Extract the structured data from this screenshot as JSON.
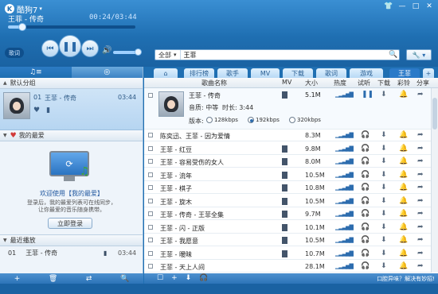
{
  "app": {
    "title": "酷狗7",
    "window_controls": [
      "shirt-icon",
      "minimize-icon",
      "maximize-icon",
      "close-icon"
    ]
  },
  "player": {
    "song_title": "王菲 - 传奇",
    "elapsed": "00:24",
    "total": "03:44",
    "progress": 0.11,
    "volume": 0.95,
    "mode_label": "歌词"
  },
  "search": {
    "scope": "全部",
    "query": "王菲",
    "tool_label": "🔧 ▾"
  },
  "left": {
    "tab_icons": [
      "playlist-icon",
      "disc-icon"
    ],
    "default_group": {
      "label": "默认分组",
      "num": "01",
      "title": "王菲 - 传奇",
      "duration": "03:44"
    },
    "favorites": {
      "label": "我的最爱",
      "welcome": "欢迎使用【我的最爱】",
      "desc1": "登录后，我的最爱列表可在线同步，",
      "desc2": "让你最爱的音乐随身携带。",
      "login_label": "立即登录"
    },
    "recent": {
      "label": "最近播放",
      "num": "01",
      "title": "王菲 - 传奇",
      "duration": "03:44"
    }
  },
  "tabs": [
    {
      "label": "⌂",
      "active": false
    },
    {
      "label": "排行榜",
      "active": false
    },
    {
      "label": "歌手",
      "active": false
    },
    {
      "label": "MV",
      "active": false
    },
    {
      "label": "下载",
      "active": false
    },
    {
      "label": "歌词",
      "active": false
    },
    {
      "label": "游戏",
      "active": false
    },
    {
      "label": "王菲",
      "active": true
    },
    {
      "label": "+",
      "active": false
    }
  ],
  "columns": {
    "name": "歌曲名称",
    "mv": "MV",
    "size": "大小",
    "heat": "热度",
    "listen": "试听",
    "download": "下载",
    "ringtone": "彩铃",
    "share": "分享"
  },
  "expanded": {
    "name": "王菲 - 传奇",
    "quality": "音质: 中等",
    "duration": "时长: 3:44",
    "size": "5.1M",
    "version_label": "版本:",
    "versions": [
      "128kbps",
      "192kbps",
      "320kbps"
    ],
    "selected_version": 1
  },
  "songs": [
    {
      "name": "陈奕迅、王菲 - 因为爱情",
      "mv": false,
      "size": "8.3M"
    },
    {
      "name": "王菲 - 红豆",
      "mv": true,
      "size": "9.8M"
    },
    {
      "name": "王菲 - 容易受伤的女人",
      "mv": true,
      "size": "8.0M"
    },
    {
      "name": "王菲 - 流年",
      "mv": true,
      "size": "10.5M"
    },
    {
      "name": "王菲 - 棋子",
      "mv": true,
      "size": "10.8M"
    },
    {
      "name": "王菲 - 旋木",
      "mv": true,
      "size": "10.5M"
    },
    {
      "name": "王菲 - 传奇 - 王菲全集",
      "mv": true,
      "size": "9.7M"
    },
    {
      "name": "王菲 - 闪 - 正版",
      "mv": true,
      "size": "10.1M"
    },
    {
      "name": "王菲 - 我愿意",
      "mv": true,
      "size": "10.5M"
    },
    {
      "name": "王菲 - 暧昧",
      "mv": true,
      "size": "10.7M"
    },
    {
      "name": "王菲 - 天上人间",
      "mv": false,
      "size": "28.1M"
    }
  ],
  "heat": "▁▂▃▅▇",
  "right_footer": {
    "help": "口腔异味？解决有妙招!"
  }
}
